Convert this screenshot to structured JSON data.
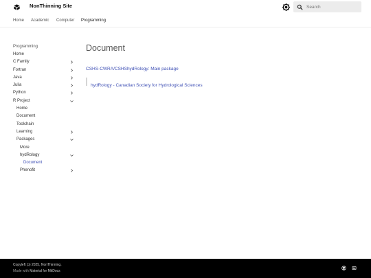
{
  "header": {
    "site_title": "NonThinning Site",
    "search_placeholder": "Search",
    "logo_icon": "book-icon",
    "palette_icon": "palette-icon"
  },
  "tabs": [
    {
      "label": "Home",
      "active": false
    },
    {
      "label": "Academic",
      "active": false
    },
    {
      "label": "Computer",
      "active": false
    },
    {
      "label": "Programming",
      "active": true
    }
  ],
  "sidebar": {
    "title": "Programming",
    "items": [
      {
        "label": "Home",
        "level": 0,
        "chevron": "none"
      },
      {
        "label": "C Family",
        "level": 0,
        "chevron": "right"
      },
      {
        "label": "Fortran",
        "level": 0,
        "chevron": "right"
      },
      {
        "label": "Java",
        "level": 0,
        "chevron": "right"
      },
      {
        "label": "Julia",
        "level": 0,
        "chevron": "right"
      },
      {
        "label": "Python",
        "level": 0,
        "chevron": "right"
      },
      {
        "label": "R Project",
        "level": 0,
        "chevron": "down"
      },
      {
        "label": "Home",
        "level": 1,
        "chevron": "none"
      },
      {
        "label": "Document",
        "level": 1,
        "chevron": "none"
      },
      {
        "label": "Toolchain",
        "level": 1,
        "chevron": "none"
      },
      {
        "label": "Learning",
        "level": 1,
        "chevron": "right"
      },
      {
        "label": "Packages",
        "level": 1,
        "chevron": "down"
      },
      {
        "label": "More",
        "level": 2,
        "chevron": "none"
      },
      {
        "label": "hydRology",
        "level": 2,
        "chevron": "down"
      },
      {
        "label": "Document",
        "level": 3,
        "chevron": "none",
        "active": true
      },
      {
        "label": "Phenofit",
        "level": 2,
        "chevron": "right"
      }
    ]
  },
  "content": {
    "title": "Document",
    "main_link": "CSHS-CWRA/CSHShydRology: Main package",
    "quote_link": "hydRology - Canadian Society for Hydrological Sciences"
  },
  "footer": {
    "copyright": "Copyleft (ↄ) 2025, NonThinning.",
    "made_prefix": "Made with ",
    "made_link": "Material for MkDocs",
    "social_icons": [
      "github-icon",
      "docker-icon"
    ]
  },
  "colors": {
    "accent": "#4051b5",
    "footer_bg": "#000000",
    "search_bg": "#ececec"
  }
}
